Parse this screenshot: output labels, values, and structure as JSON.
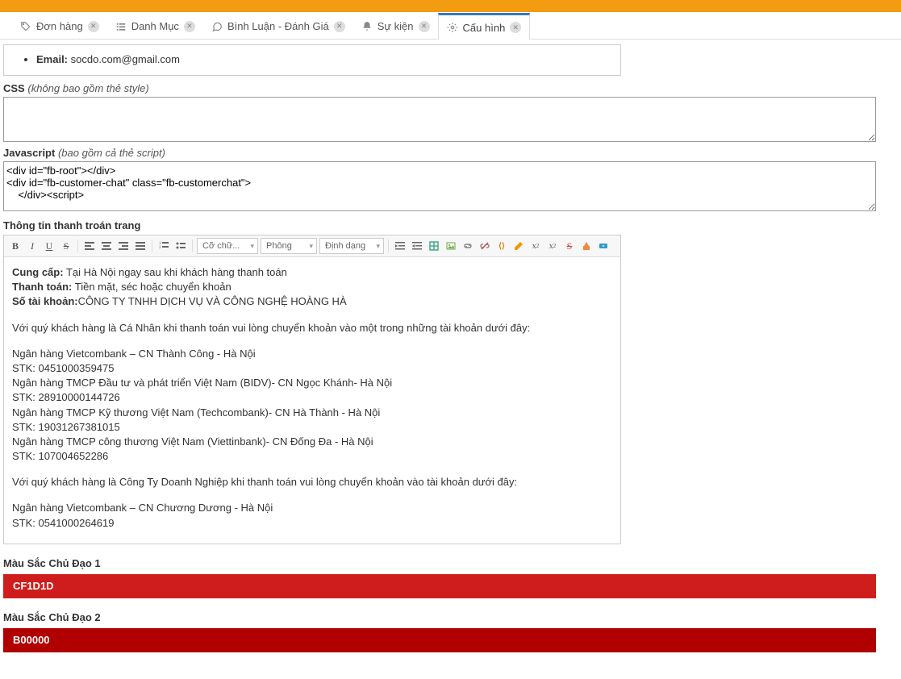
{
  "tabs": [
    {
      "label": "Đơn hàng"
    },
    {
      "label": "Danh Mục"
    },
    {
      "label": "Bình Luận - Đánh Giá"
    },
    {
      "label": "Sự kiện"
    },
    {
      "label": "Cấu hình"
    }
  ],
  "email": {
    "label": "Email:",
    "value": "socdo.com@gmail.com"
  },
  "css": {
    "label": "CSS",
    "hint": "(không bao gồm thẻ style)",
    "value": ""
  },
  "js": {
    "label": "Javascript",
    "hint": "(bao gồm cả thẻ script)",
    "value": "<div id=\"fb-root\"></div>\n<div id=\"fb-customer-chat\" class=\"fb-customerchat\">\n    </div><script>"
  },
  "payment": {
    "title": "Thông tin thanh troán trang",
    "font_select": "Cỡ chữ...",
    "font_family_select": "Phông",
    "format_select": "Định dạng",
    "body": {
      "l1b": "Cung cấp:",
      "l1": " Tại Hà Nội ngay sau khi khách hàng thanh toán",
      "l2b": "Thanh toán:",
      "l2": " Tiền mặt, séc hoặc chuyển khoản",
      "l3b": "Số tài khoản:",
      "l3": "CÔNG TY TNHH DỊCH VỤ VÀ CÔNG NGHỆ HOÀNG HÀ",
      "l4": "Với quý khách hàng là Cá Nhân khi thanh toán vui lòng chuyển khoản vào một trong những tài khoản dưới đây:",
      "l5": "Ngân hàng Vietcombank – CN Thành Công - Hà Nội",
      "l6": "STK: 0451000359475",
      "l7": "Ngân hàng TMCP Đầu tư và phát triển Việt Nam (BIDV)- CN Ngọc Khánh- Hà Nội",
      "l8": "STK: 28910000144726",
      "l9": "Ngân hàng TMCP Kỹ thương Việt Nam (Techcombank)- CN Hà Thành - Hà Nội",
      "l10": "STK: 19031267381015",
      "l11": "Ngân hàng TMCP công thương Việt Nam (Viettinbank)- CN Đống Đa - Hà Nội",
      "l12": "STK: 107004652286",
      "l13": "Với quý khách hàng là Công Ty Doanh Nghiệp khi thanh toán vui lòng chuyển khoản vào tài khoản dưới đây:",
      "l14": "Ngân hàng Vietcombank – CN Chương Dương - Hà Nội",
      "l15": "STK: 0541000264619"
    }
  },
  "color1": {
    "label": "Màu Sắc Chủ Đạo 1",
    "value": "CF1D1D"
  },
  "color2": {
    "label": "Màu Sắc Chủ Đạo 2",
    "value": "B00000"
  }
}
